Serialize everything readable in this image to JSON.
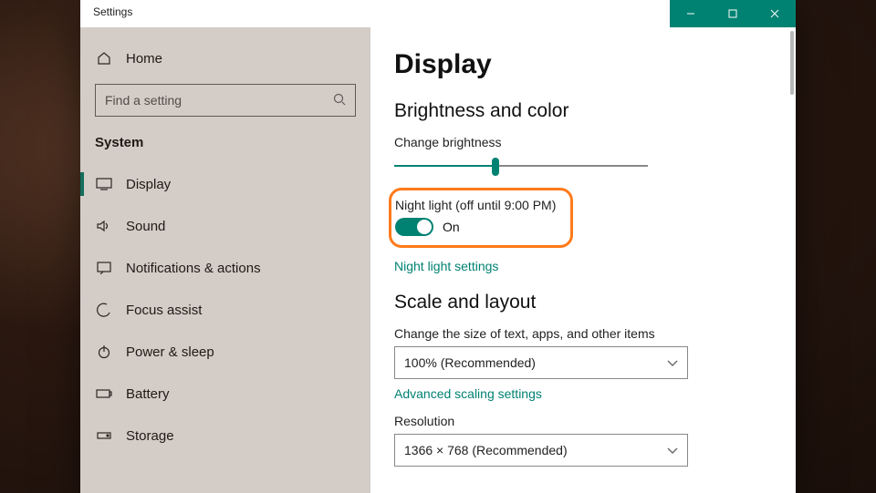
{
  "window": {
    "title": "Settings"
  },
  "sidebar": {
    "home": "Home",
    "search_placeholder": "Find a setting",
    "category": "System",
    "items": [
      {
        "label": "Display"
      },
      {
        "label": "Sound"
      },
      {
        "label": "Notifications & actions"
      },
      {
        "label": "Focus assist"
      },
      {
        "label": "Power & sleep"
      },
      {
        "label": "Battery"
      },
      {
        "label": "Storage"
      }
    ]
  },
  "page": {
    "title": "Display",
    "section_brightness": "Brightness and color",
    "brightness_label": "Change brightness",
    "brightness_percent": 40,
    "night_light_label": "Night light (off until 9:00 PM)",
    "night_light_state": "On",
    "night_light_link": "Night light settings",
    "section_scale": "Scale and layout",
    "scale_label": "Change the size of text, apps, and other items",
    "scale_value": "100% (Recommended)",
    "advanced_scaling_link": "Advanced scaling settings",
    "resolution_label": "Resolution",
    "resolution_value": "1366 × 768 (Recommended)"
  },
  "colors": {
    "accent": "#008272",
    "highlight": "#ff7a1a"
  }
}
